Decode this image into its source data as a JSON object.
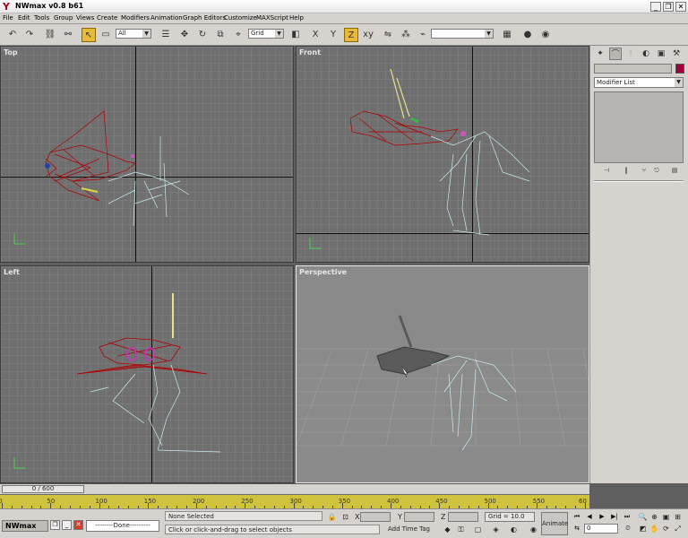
{
  "window": {
    "title": "NWmax v0.8 b61",
    "minimize": "_",
    "restore": "❐",
    "close": "✕"
  },
  "menu": [
    "File",
    "Edit",
    "Tools",
    "Group",
    "Views",
    "Create",
    "Modifiers",
    "Animation",
    "Graph Editors",
    "Customize",
    "MAXScript",
    "Help"
  ],
  "toolbar": {
    "selection_filter": "All",
    "ref_coord": "Grid",
    "named_selection": ""
  },
  "viewports": [
    {
      "label": "Top"
    },
    {
      "label": "Front"
    },
    {
      "label": "Left"
    },
    {
      "label": "Perspective"
    }
  ],
  "command_panel": {
    "modifier_list": "Modifier List",
    "object_color": "#a2003c"
  },
  "time_slider": {
    "label": "0 / 600",
    "ticks": [
      "0",
      "50",
      "100",
      "150",
      "200",
      "250",
      "300",
      "350",
      "400",
      "450",
      "500",
      "550",
      "60"
    ]
  },
  "status": {
    "taskbar_label": "NWmax",
    "done_text": "--------Done---------",
    "selection": "None Selected",
    "prompt": "Click or click-and-drag to select objects",
    "x_label": "X",
    "y_label": "Y",
    "z_label": "Z",
    "grid": "Grid = 10.0",
    "add_time_tag": "Add Time Tag",
    "animate": "Animate",
    "frame": "0"
  },
  "colors": {
    "mesh": "#b00000",
    "bones": "#c9ecef",
    "accent": "#e9b93a"
  }
}
